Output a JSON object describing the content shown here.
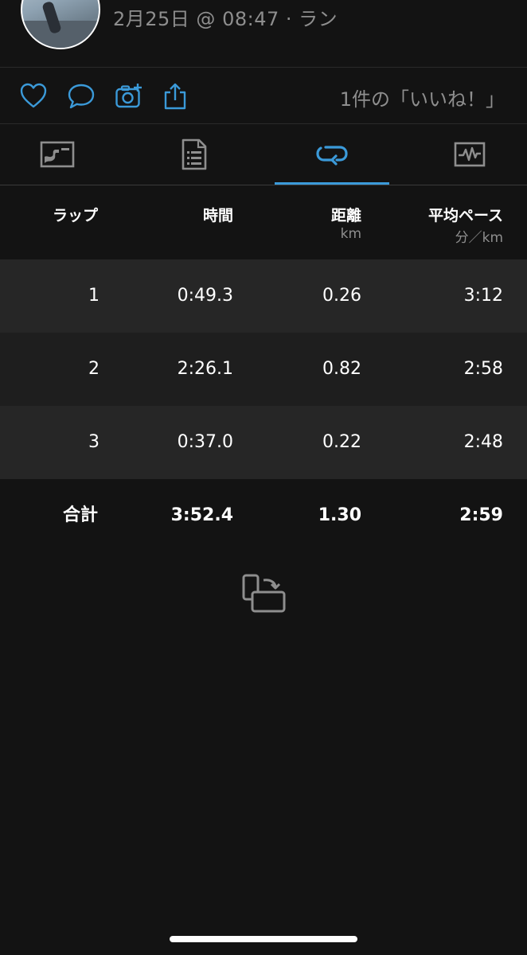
{
  "header": {
    "subtitle": "2月25日 @ 08:47 · ラン"
  },
  "actions": {
    "items": [
      {
        "icon": "heart-icon"
      },
      {
        "icon": "comment-icon"
      },
      {
        "icon": "add-photo-icon"
      },
      {
        "icon": "share-icon"
      }
    ],
    "likes_text": "1件の「いいね！」",
    "accent_color": "#3b9ad9"
  },
  "tabs": [
    {
      "icon": "map-icon",
      "active": false
    },
    {
      "icon": "details-icon",
      "active": false
    },
    {
      "icon": "laps-icon",
      "active": true
    },
    {
      "icon": "charts-icon",
      "active": false
    }
  ],
  "table": {
    "columns": [
      {
        "label": "ラップ",
        "sub": ""
      },
      {
        "label": "時間",
        "sub": ""
      },
      {
        "label": "距離",
        "sub": "km"
      },
      {
        "label": "平均ペース",
        "sub": "分／km"
      }
    ],
    "rows": [
      {
        "lap": "1",
        "time": "0:49.3",
        "distance": "0.26",
        "pace": "3:12"
      },
      {
        "lap": "2",
        "time": "2:26.1",
        "distance": "0.82",
        "pace": "2:58"
      },
      {
        "lap": "3",
        "time": "0:37.0",
        "distance": "0.22",
        "pace": "2:48"
      }
    ],
    "total": {
      "label": "合計",
      "time": "3:52.4",
      "distance": "1.30",
      "pace": "2:59"
    }
  },
  "rotate_icon": "rotate-device-icon"
}
